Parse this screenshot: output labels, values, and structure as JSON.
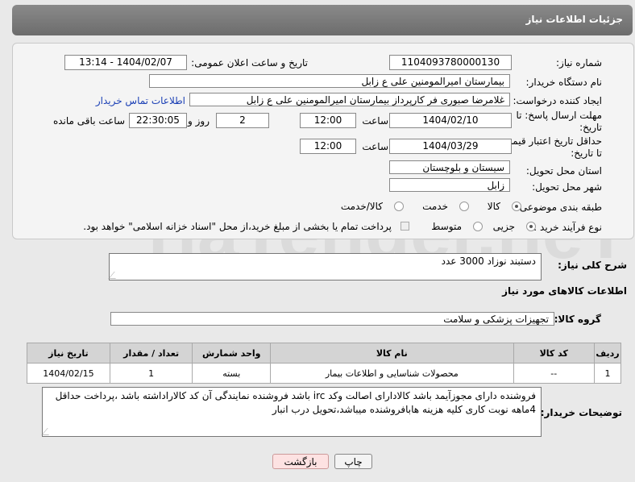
{
  "header": {
    "title": "جزئیات اطلاعات نیاز"
  },
  "form": {
    "need_number_label": "شماره نیاز:",
    "need_number": "1104093780000130",
    "announce_label": "تاریخ و ساعت اعلان عمومی:",
    "announce_value": "1404/02/07 - 13:14",
    "buyer_label": "نام دستگاه خریدار:",
    "buyer_value": "بیمارستان امیرالمومنین علی  ع  زابل",
    "creator_label": "ایجاد کننده درخواست:",
    "creator_value": "غلامرضا صبوری فر کارپرداز بیمارستان امیرالمومنین علی  ع  زابل",
    "contact_link": "اطلاعات تماس خریدار",
    "deadline_label_1": "مهلت ارسال پاسخ: تا",
    "deadline_label_2": "تاریخ:",
    "deadline_date": "1404/02/10",
    "time_label": "ساعت",
    "deadline_time": "12:00",
    "days_value": "2",
    "days_label": "روز و",
    "remaining_value": "22:30:05",
    "remaining_label": "ساعت باقی مانده",
    "validity_label_1": "حداقل تاریخ اعتبار قیمت:",
    "validity_label_2": "تا تاریخ:",
    "validity_date": "1404/03/29",
    "validity_time": "12:00",
    "province_label": "استان محل تحویل:",
    "province_value": "سیستان و بلوچستان",
    "city_label": "شهر محل تحویل:",
    "city_value": "زابل",
    "category_label": "طبقه بندی موضوعی:",
    "category_options": [
      "کالا",
      "خدمت",
      "کالا/خدمت"
    ],
    "category_selected": "کالا",
    "process_label": "نوع فرآیند خرید :",
    "process_options": [
      "جزیی",
      "متوسط"
    ],
    "process_selected": "جزیی",
    "payment_note": "پرداخت تمام یا بخشی از مبلغ خرید،از محل \"اسناد خزانه اسلامی\" خواهد بود."
  },
  "description": {
    "label": "شرح کلی نیاز:",
    "value": "دستبند نوزاد 3000 عدد"
  },
  "goods_section": {
    "title": "اطلاعات کالاهای مورد نیاز",
    "group_label": "گروه کالا:",
    "group_value": "تجهیزات پزشکی و سلامت"
  },
  "table": {
    "headers": [
      "ردیف",
      "کد کالا",
      "نام کالا",
      "واحد شمارش",
      "تعداد / مقدار",
      "تاریخ نیاز"
    ],
    "rows": [
      [
        "1",
        "--",
        "محصولات شناسایی و اطلاعات بیمار",
        "بسته",
        "1",
        "1404/02/15"
      ]
    ]
  },
  "buyer_notes": {
    "label": "توضیحات خریدار:",
    "value": "فروشنده دارای مجوزآیمد باشد کالادارای اصالت وکد irc باشد فروشنده نمایندگی آن کد کالاراداشته باشد ،پرداخت حداقل 4ماهه نوبت کاری کلیه هزینه هابافروشنده میباشد،تحویل درب انبار"
  },
  "buttons": {
    "print": "چاپ",
    "back": "بازگشت"
  },
  "watermark": {
    "text": "AriaTender.neT"
  },
  "colors": {
    "header": "#777777",
    "link": "#1a3fb5",
    "back_button": "#fde2e2"
  }
}
